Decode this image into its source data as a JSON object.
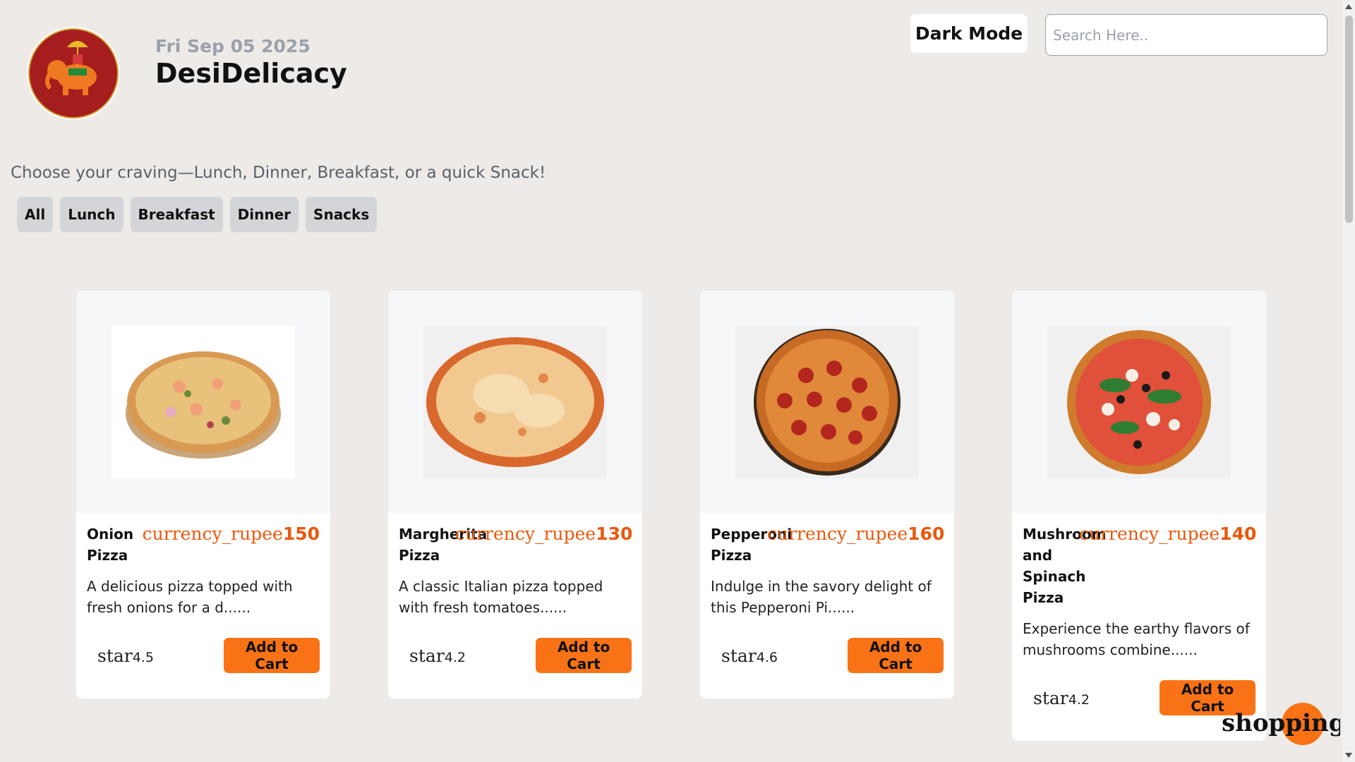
{
  "header": {
    "date": "Fri Sep 05 2025",
    "brand": "DesiDelicacy",
    "logo_text": "DesiDelicacy",
    "dark_mode_label": "Dark Mode",
    "search_placeholder": "Search Here.."
  },
  "tagline": "Choose your craving—Lunch, Dinner, Breakfast, or a quick Snack!",
  "categories": [
    "All",
    "Lunch",
    "Breakfast",
    "Dinner",
    "Snacks"
  ],
  "products": [
    {
      "name": "Onion Pizza",
      "price_icon": "currency_rupee",
      "price": "150",
      "description": "A delicious pizza topped with fresh onions for a d......",
      "rating_icon": "star",
      "rating": "4.5",
      "cart_label": "Add to Cart"
    },
    {
      "name": "Margherita Pizza",
      "price_icon": "currency_rupee",
      "price": "130",
      "description": "A classic Italian pizza topped with fresh tomatoes......",
      "rating_icon": "star",
      "rating": "4.2",
      "cart_label": "Add to Cart"
    },
    {
      "name": "Pepperoni Pizza",
      "price_icon": "currency_rupee",
      "price": "160",
      "description": "Indulge in the savory delight of this Pepperoni Pi......",
      "rating_icon": "star",
      "rating": "4.6",
      "cart_label": "Add to Cart"
    },
    {
      "name": "Mushroom and Spinach Pizza",
      "price_icon": "currency_rupee",
      "price": "140",
      "description": "Experience the earthy flavors of mushrooms combine......",
      "rating_icon": "star",
      "rating": "4.2",
      "cart_label": "Add to Cart"
    }
  ],
  "cart_fab_label": "shopping_cart",
  "colors": {
    "background": "#edeae7",
    "accent": "#f97316",
    "price": "#ea580c",
    "muted": "#9aa1ab"
  }
}
